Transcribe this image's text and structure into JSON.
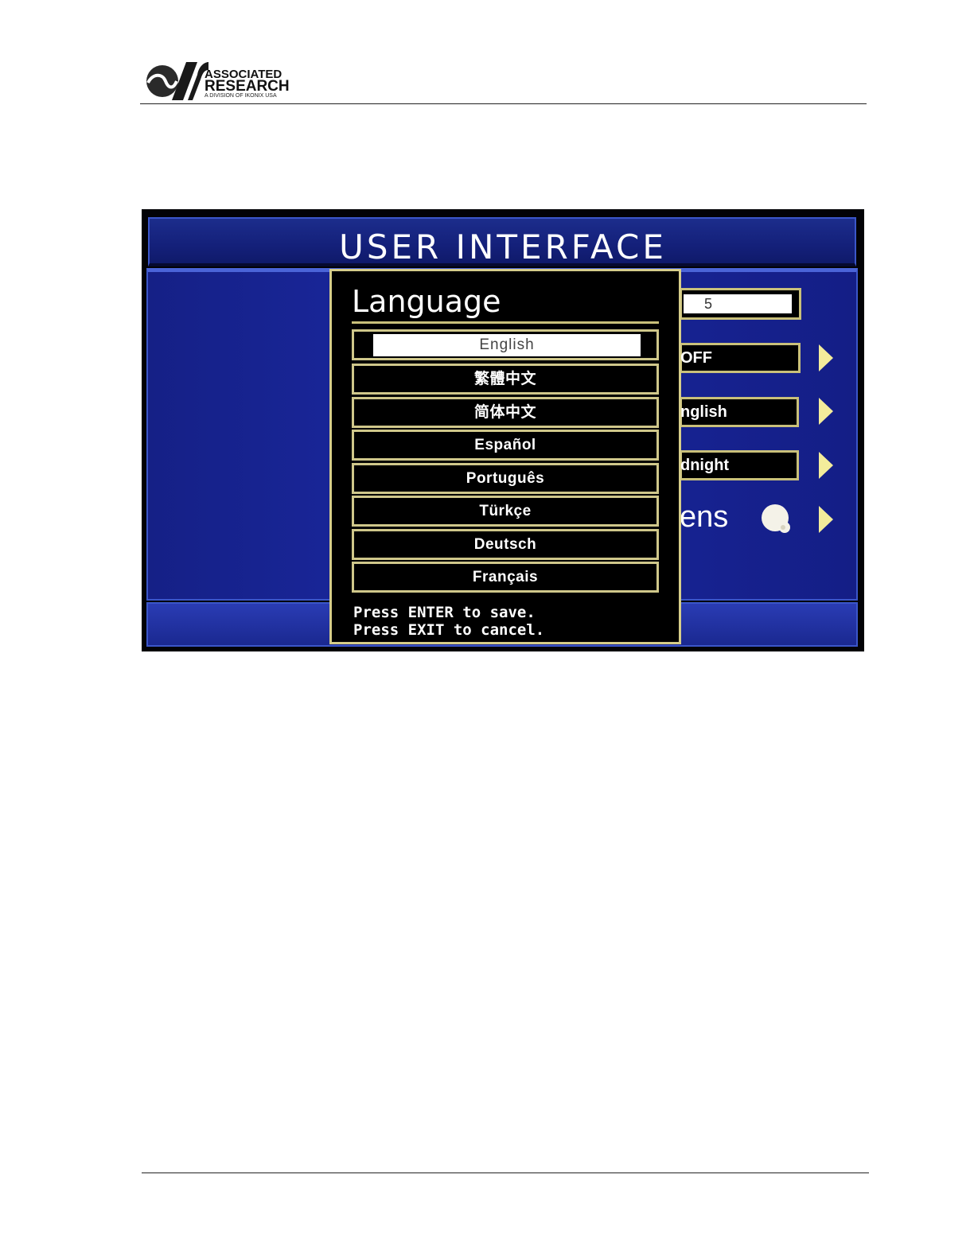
{
  "header": {
    "logo_line1": "ASSOCIATED",
    "logo_line2": "RESEARCH",
    "logo_line3": "A DIVISION OF IKONIX USA"
  },
  "screen": {
    "title": "USER INTERFACE",
    "fields": {
      "timeout_value": "5",
      "field2_value": "OFF",
      "field3_value": "nglish",
      "field4_value": "dnight",
      "screensaver_label": "ens"
    },
    "dialog": {
      "title": "Language",
      "options": [
        {
          "label": "English",
          "selected": true
        },
        {
          "label": "繁體中文"
        },
        {
          "label": "简体中文"
        },
        {
          "label": "Español"
        },
        {
          "label": "Português"
        },
        {
          "label": "Türkçe"
        },
        {
          "label": "Deutsch"
        },
        {
          "label": "Français"
        }
      ],
      "save_hint": "Press ENTER to save.",
      "cancel_hint": "Press EXIT to cancel."
    }
  },
  "colors": {
    "panel_blue": "#1a28a0",
    "border_gold": "#d6cd8a",
    "arrow_yellow": "#f3ec9b"
  }
}
